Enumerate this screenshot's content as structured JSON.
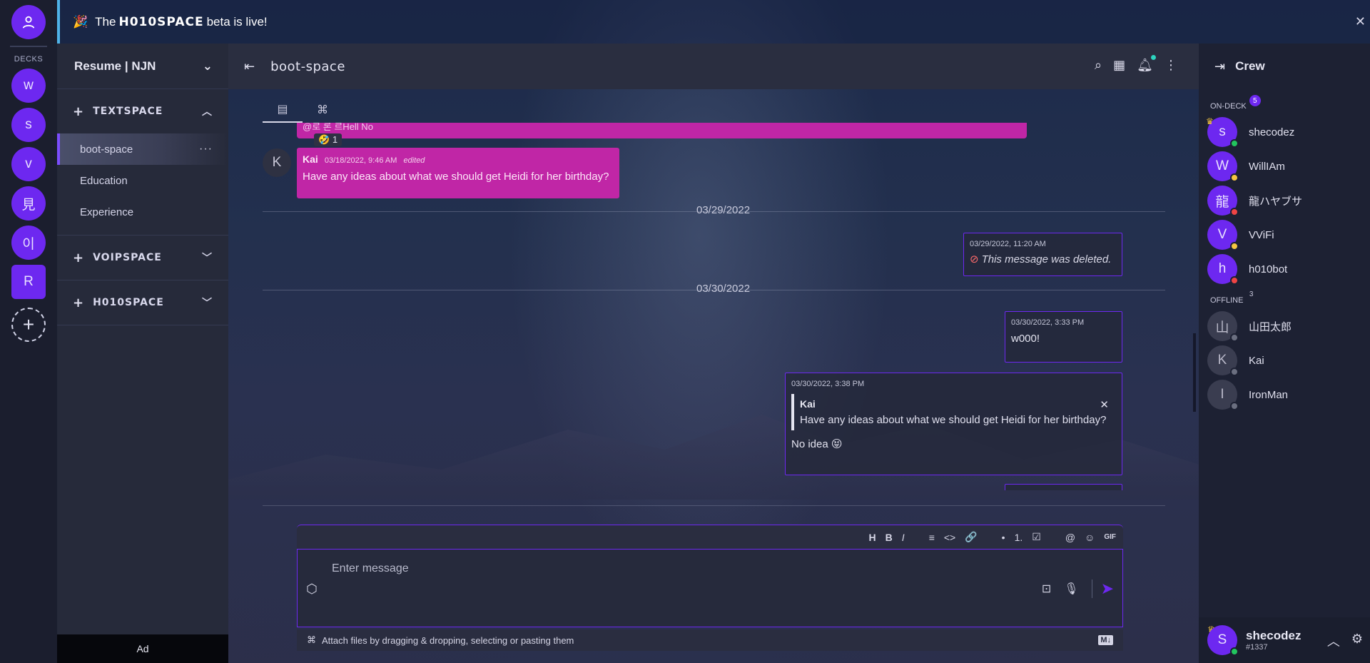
{
  "banner": {
    "prefix": "The",
    "brand": "H010SPACE",
    "suffix": "beta is live!"
  },
  "rail": {
    "decks_label": "DECKS",
    "decks": [
      "w",
      "s",
      "v",
      "見",
      "이",
      "R"
    ]
  },
  "sidebar": {
    "deck_title": "Resume | NJN",
    "sections": [
      {
        "label": "TEXTSPACE",
        "channels": [
          "boot-space",
          "Education",
          "Experience"
        ]
      },
      {
        "label": "VOIPSPACE"
      },
      {
        "label": "H010SPACE"
      }
    ],
    "ad_label": "Ad"
  },
  "channel": {
    "name": "boot-space"
  },
  "messages": {
    "strip_text": "@로 론 르Hell No",
    "reaction": {
      "emoji": "🤣",
      "count": "1"
    },
    "kai_avatar": "K",
    "kai_msg": {
      "author": "Kai",
      "time": "03/18/2022, 9:46 AM",
      "edited": "edited",
      "text": "Have any ideas about what we should get Heidi for her birthday?"
    },
    "date1": "03/29/2022",
    "deleted_msg": {
      "time": "03/29/2022, 11:20 AM",
      "text": "This message was deleted."
    },
    "date2": "03/30/2022",
    "msg_w000": {
      "time": "03/30/2022, 3:33 PM",
      "text": "w000!"
    },
    "reply_msg": {
      "time": "03/30/2022, 3:38 PM",
      "quote_author": "Kai",
      "quote_text": "Have any ideas about what we should get Heidi for her birthday?",
      "text": "No idea 😝"
    }
  },
  "composer": {
    "placeholder": "Enter message",
    "toolbar": [
      "H",
      "B",
      "I",
      "≡",
      "<>",
      "🔗",
      "•",
      "1.",
      "☑",
      "@",
      "☺",
      "GIF"
    ],
    "attach_text": "Attach files by dragging & dropping, selecting or pasting them",
    "md_badge": "M↓"
  },
  "crew": {
    "title": "Crew",
    "on_deck_label": "ON-DECK",
    "on_deck_count": "5",
    "offline_label": "OFFLINE",
    "offline_count": "3",
    "online": [
      {
        "initial": "s",
        "name": "shecodez",
        "status_color": "#22c55e",
        "crown": true
      },
      {
        "initial": "W",
        "name": "WillIAm",
        "status_color": "#f5c542"
      },
      {
        "initial": "龍",
        "name": "龍ハヤブサ",
        "status_color": "#ef4444"
      },
      {
        "initial": "V",
        "name": "VViFi",
        "status_color": "#f5c542"
      },
      {
        "initial": "h",
        "name": "h010bot",
        "status_color": "#ef4444"
      }
    ],
    "offline": [
      {
        "initial": "山",
        "name": "山田太郎"
      },
      {
        "initial": "K",
        "name": "Kai"
      },
      {
        "initial": "I",
        "name": "IronMan"
      }
    ],
    "me": {
      "initial": "S",
      "name": "shecodez",
      "tag": "#1337"
    }
  }
}
